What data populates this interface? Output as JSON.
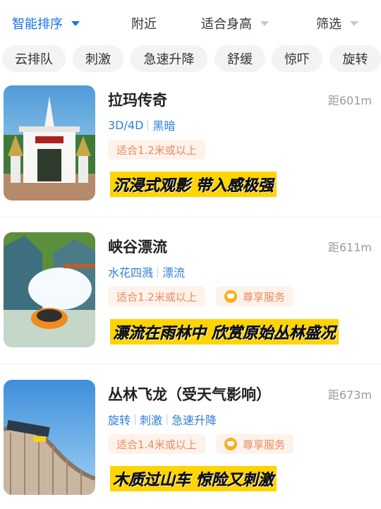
{
  "filters": {
    "sort": "智能排序",
    "nearby": "附近",
    "height": "适合身高",
    "screen": "筛选"
  },
  "chips": [
    "云排队",
    "刺激",
    "急速升降",
    "舒缓",
    "惊吓",
    "旋转"
  ],
  "colors": {
    "accent": "#1a73e8",
    "tag": "#2f7ed8",
    "pill_bg": "#fff2ea",
    "pill_text": "#e98b62",
    "slogan_bg": "#ffd400"
  },
  "items": [
    {
      "title": "拉玛传奇",
      "distance": "距601m",
      "tags": [
        "3D/4D",
        "黑暗"
      ],
      "height_req": "适合1.2米或以上",
      "service": "",
      "slogan": "沉浸式观影 带入感极强",
      "image": "temple-gate"
    },
    {
      "title": "峡谷漂流",
      "distance": "距611m",
      "tags": [
        "水花四溅",
        "漂流"
      ],
      "height_req": "适合1.2米或以上",
      "service": "尊享服务",
      "slogan": "漂流在雨林中 欣赏原始丛林盛况",
      "image": "river-rafting"
    },
    {
      "title": "丛林飞龙（受天气影响）",
      "distance": "距673m",
      "tags": [
        "旋转",
        "刺激",
        "急速升降"
      ],
      "height_req": "适合1.4米或以上",
      "service": "尊享服务",
      "slogan": "木质过山车 惊险又刺激",
      "image": "wooden-coaster"
    }
  ]
}
